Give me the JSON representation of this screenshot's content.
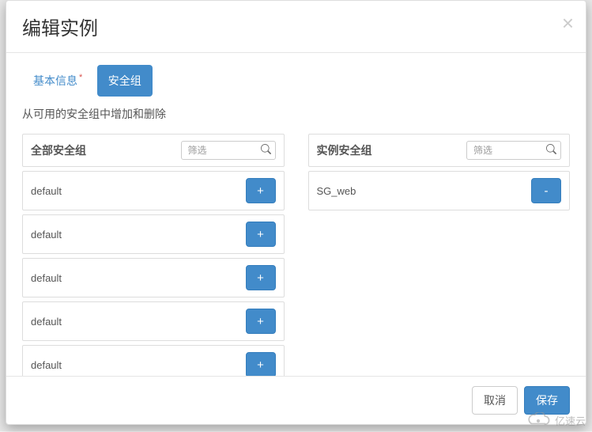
{
  "modal": {
    "title": "编辑实例",
    "close_label": "×"
  },
  "tabs": {
    "basic": "基本信息",
    "asterisk": "*",
    "security": "安全组"
  },
  "subtitle": "从可用的安全组中增加和删除",
  "left_panel": {
    "title": "全部安全组",
    "filter_placeholder": "筛选",
    "items": [
      {
        "name": "default",
        "action": "+"
      },
      {
        "name": "default",
        "action": "+"
      },
      {
        "name": "default",
        "action": "+"
      },
      {
        "name": "default",
        "action": "+"
      },
      {
        "name": "default",
        "action": "+"
      }
    ]
  },
  "right_panel": {
    "title": "实例安全组",
    "filter_placeholder": "筛选",
    "items": [
      {
        "name": "SG_web",
        "action": "-"
      }
    ]
  },
  "footer": {
    "cancel": "取消",
    "save": "保存"
  },
  "watermark": {
    "text": "亿速云"
  },
  "colors": {
    "primary": "#428bca",
    "danger": "#d9534f"
  }
}
